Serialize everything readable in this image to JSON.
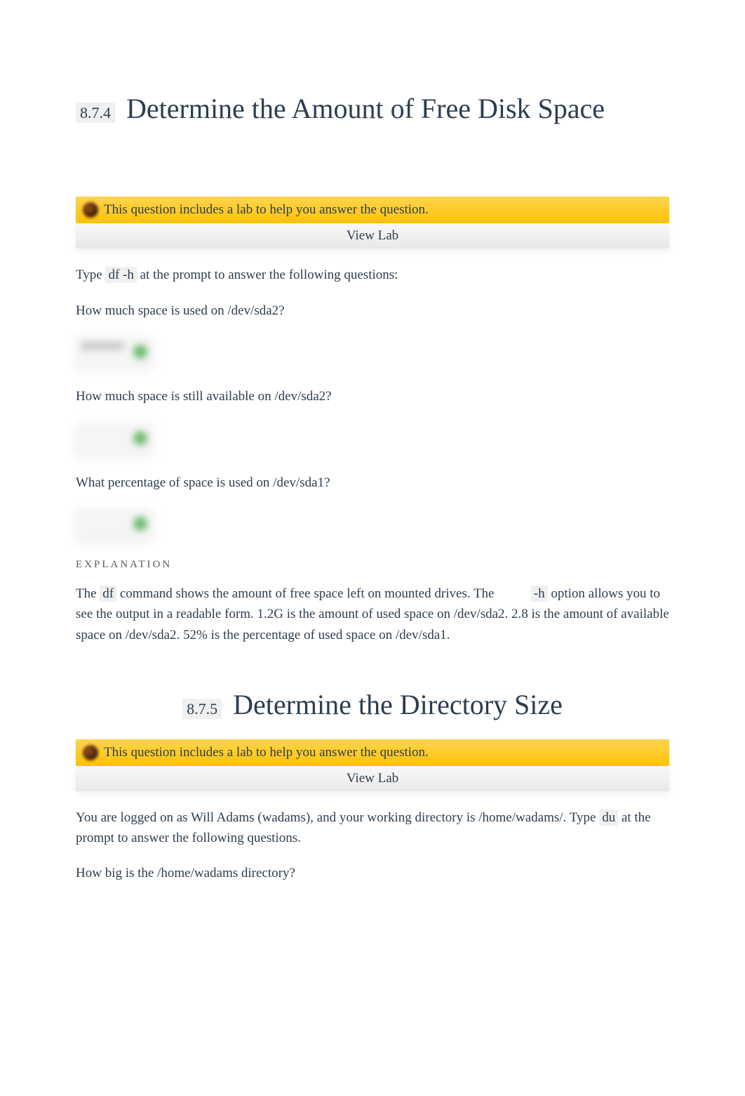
{
  "section1": {
    "number": "8.7.4",
    "title": "Determine the Amount of Free Disk Space",
    "lab_text": "This question includes a lab to help you answer the question.",
    "view_lab": "View Lab",
    "intro_pre": "Type ",
    "intro_cmd": "df -h",
    "intro_post": " at the prompt to answer the following questions:",
    "q1": "How much space is used on /dev/sda2?",
    "q2": "How much space is still available on /dev/sda2?",
    "q3": "What percentage of space is used on /dev/sda1?",
    "explanation_label": "EXPLANATION",
    "exp_pre": "The ",
    "exp_cmd1": "df",
    "exp_mid1": " command shows the amount of free space left on mounted drives. The",
    "exp_gap": "           ",
    "exp_cmd2": "-h",
    "exp_post": " option allows you to see the output in a readable form. 1.2G is the amount of used space on /dev/sda2. 2.8 is the amount of available space on /dev/sda2. 52% is the percentage of used space on /dev/sda1."
  },
  "section2": {
    "number": "8.7.5",
    "title": "Determine the Directory Size",
    "lab_text": "This question includes a lab to help you answer the question.",
    "view_lab": "View Lab",
    "intro1": "You are logged on as Will Adams (wadams), and your working directory is /home/wadams/. Type ",
    "intro_cmd": "du",
    "intro2": " at the prompt to answer the following questions.",
    "q1": "How big is the /home/wadams directory?"
  }
}
